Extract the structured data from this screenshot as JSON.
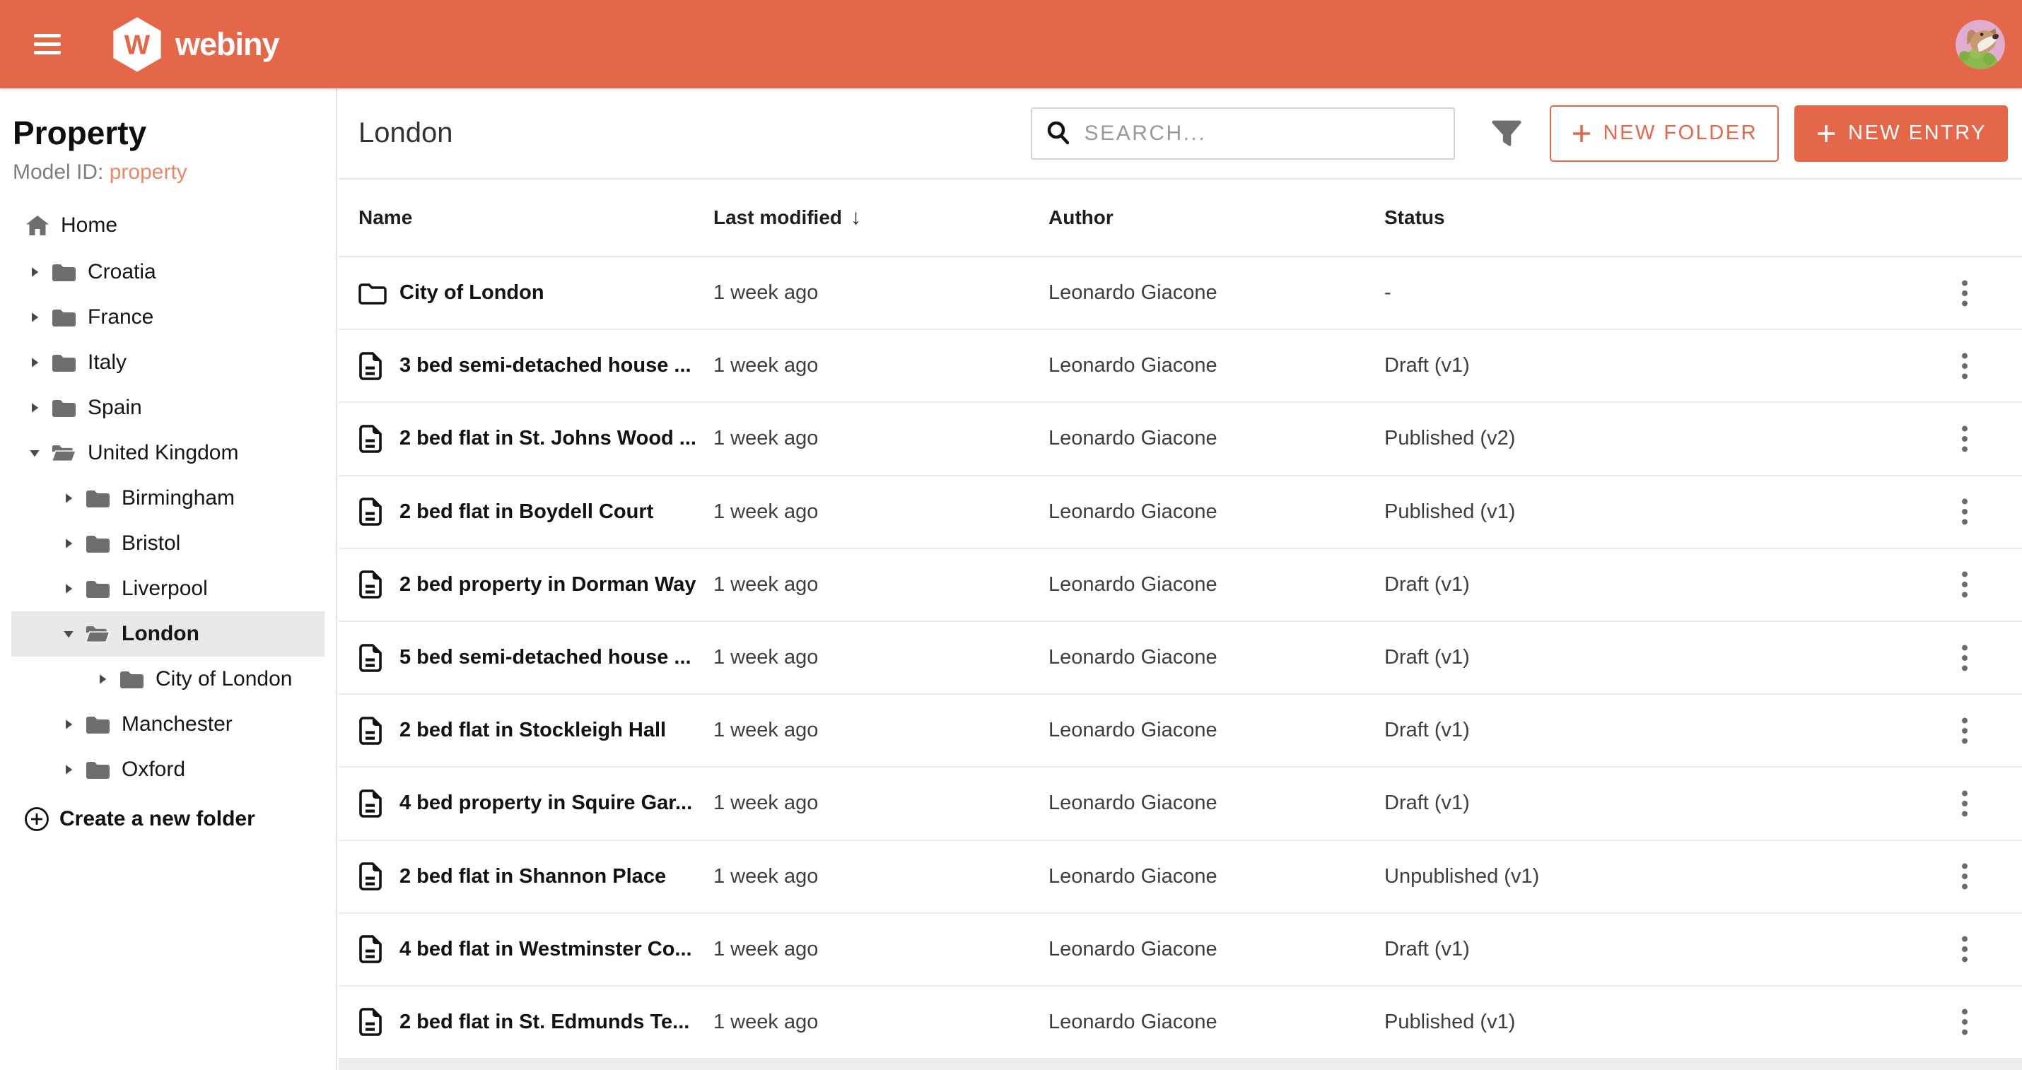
{
  "topbar": {
    "brand": "webiny",
    "logo_letter": "W"
  },
  "sidebar": {
    "title": "Property",
    "model_id_label": "Model ID:",
    "model_id_value": "property",
    "home_label": "Home",
    "create_folder_label": "Create a new folder",
    "tree": [
      {
        "label": "Croatia",
        "level": 0,
        "expanded": false,
        "selected": false
      },
      {
        "label": "France",
        "level": 0,
        "expanded": false,
        "selected": false
      },
      {
        "label": "Italy",
        "level": 0,
        "expanded": false,
        "selected": false
      },
      {
        "label": "Spain",
        "level": 0,
        "expanded": false,
        "selected": false
      },
      {
        "label": "United Kingdom",
        "level": 0,
        "expanded": true,
        "selected": false
      },
      {
        "label": "Birmingham",
        "level": 1,
        "expanded": false,
        "selected": false
      },
      {
        "label": "Bristol",
        "level": 1,
        "expanded": false,
        "selected": false
      },
      {
        "label": "Liverpool",
        "level": 1,
        "expanded": false,
        "selected": false
      },
      {
        "label": "London",
        "level": 1,
        "expanded": true,
        "selected": true
      },
      {
        "label": "City of London",
        "level": 2,
        "expanded": false,
        "selected": false
      },
      {
        "label": "Manchester",
        "level": 1,
        "expanded": false,
        "selected": false
      },
      {
        "label": "Oxford",
        "level": 1,
        "expanded": false,
        "selected": false
      }
    ]
  },
  "header": {
    "title": "London",
    "search_placeholder": "SEARCH...",
    "new_folder_label": "NEW FOLDER",
    "new_entry_label": "NEW ENTRY"
  },
  "table": {
    "columns": {
      "name": "Name",
      "modified": "Last modified",
      "author": "Author",
      "status": "Status"
    },
    "sort_arrow": "↓",
    "rows": [
      {
        "type": "folder",
        "name": "City of London",
        "modified": "1 week ago",
        "author": "Leonardo Giacone",
        "status": "-"
      },
      {
        "type": "entry",
        "name": "3 bed semi-detached house ...",
        "modified": "1 week ago",
        "author": "Leonardo Giacone",
        "status": "Draft (v1)"
      },
      {
        "type": "entry",
        "name": "2 bed flat in St. Johns Wood ...",
        "modified": "1 week ago",
        "author": "Leonardo Giacone",
        "status": "Published (v2)"
      },
      {
        "type": "entry",
        "name": "2 bed flat in Boydell Court",
        "modified": "1 week ago",
        "author": "Leonardo Giacone",
        "status": "Published (v1)"
      },
      {
        "type": "entry",
        "name": "2 bed property in Dorman Way",
        "modified": "1 week ago",
        "author": "Leonardo Giacone",
        "status": "Draft (v1)"
      },
      {
        "type": "entry",
        "name": "5 bed semi-detached house ...",
        "modified": "1 week ago",
        "author": "Leonardo Giacone",
        "status": "Draft (v1)"
      },
      {
        "type": "entry",
        "name": "2 bed flat in Stockleigh Hall",
        "modified": "1 week ago",
        "author": "Leonardo Giacone",
        "status": "Draft (v1)"
      },
      {
        "type": "entry",
        "name": "4 bed property in Squire Gar...",
        "modified": "1 week ago",
        "author": "Leonardo Giacone",
        "status": "Draft (v1)"
      },
      {
        "type": "entry",
        "name": "2 bed flat in Shannon Place",
        "modified": "1 week ago",
        "author": "Leonardo Giacone",
        "status": "Unpublished (v1)"
      },
      {
        "type": "entry",
        "name": "4 bed flat in Westminster Co...",
        "modified": "1 week ago",
        "author": "Leonardo Giacone",
        "status": "Draft (v1)"
      },
      {
        "type": "entry",
        "name": "2 bed flat in St. Edmunds Te...",
        "modified": "1 week ago",
        "author": "Leonardo Giacone",
        "status": "Published (v1)"
      }
    ]
  },
  "colors": {
    "primary": "#e5674a",
    "primary_light": "#ee8765",
    "selected_row": "#e8e8e8"
  }
}
